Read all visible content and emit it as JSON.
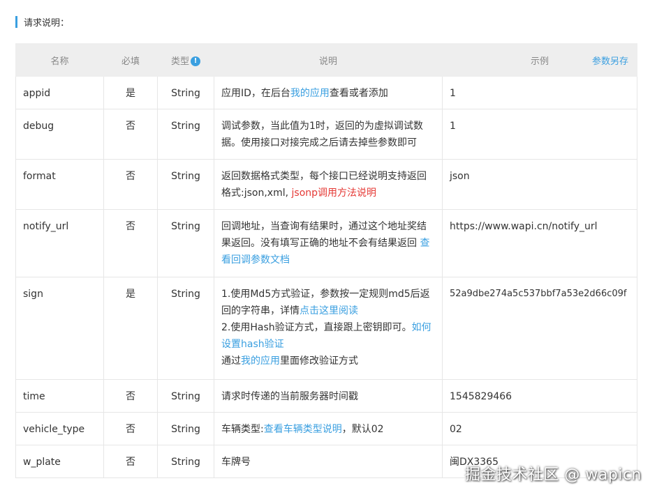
{
  "section": {
    "title": "请求说明："
  },
  "table": {
    "headers": {
      "name": "名称",
      "required": "必填",
      "type": "类型",
      "desc": "说明",
      "example": "示例",
      "save_params": "参数另存"
    },
    "rows": [
      {
        "name": "appid",
        "required": "是",
        "type": "String",
        "desc": {
          "t1": "应用ID，在后台",
          "l1": "我的应用",
          "t2": "查看或者添加"
        },
        "example": "1"
      },
      {
        "name": "debug",
        "required": "否",
        "type": "String",
        "desc": {
          "t1": "调试参数，当此值为1时，返回的为虚拟调试数据。使用接口对接完成之后请去掉些参数即可"
        },
        "example": "1"
      },
      {
        "name": "format",
        "required": "否",
        "type": "String",
        "desc": {
          "t1": "返回数据格式类型，每个接口已经说明支持返回格式:json,xml, ",
          "l1": "jsonp调用方法说明"
        },
        "example": "json"
      },
      {
        "name": "notify_url",
        "required": "否",
        "type": "String",
        "desc": {
          "t1": "回调地址，当查询有结果时，通过这个地址奖结果返回。没有填写正确的地址不会有结果返回 ",
          "l1": "查看回调参数文档"
        },
        "example": "https://www.wapi.cn/notify_url"
      },
      {
        "name": "sign",
        "required": "是",
        "type": "String",
        "desc": {
          "t1": "1.使用Md5方式验证，参数按一定规则md5后返回的字符串，详情",
          "l1": "点击这里阅读",
          "t2": "2.使用Hash验证方式，直接跟上密钥即可。",
          "l2": "如何设置hash验证",
          "t3": "通过",
          "l3": "我的应用",
          "t4": "里面修改验证方式"
        },
        "example": "52a9dbe274a5c537bbf7a53e2d66c09f"
      },
      {
        "name": "time",
        "required": "否",
        "type": "String",
        "desc": {
          "t1": "请求时传递的当前服务器时间戳"
        },
        "example": "1545829466"
      },
      {
        "name": "vehicle_type",
        "required": "否",
        "type": "String",
        "desc": {
          "t1": "车辆类型:",
          "l1": "查看车辆类型说明",
          "t2": "，默认02"
        },
        "example": "02"
      },
      {
        "name": "w_plate",
        "required": "否",
        "type": "String",
        "desc": {
          "t1": "车牌号"
        },
        "example": "闽DX3365"
      }
    ]
  },
  "watermark": "掘金技术社区 @ wapicn",
  "colors": {
    "accent": "#3a9fe0",
    "required": "#e53935",
    "header_bg": "#eeeeee"
  },
  "icons": {
    "type_info": "info-icon"
  }
}
